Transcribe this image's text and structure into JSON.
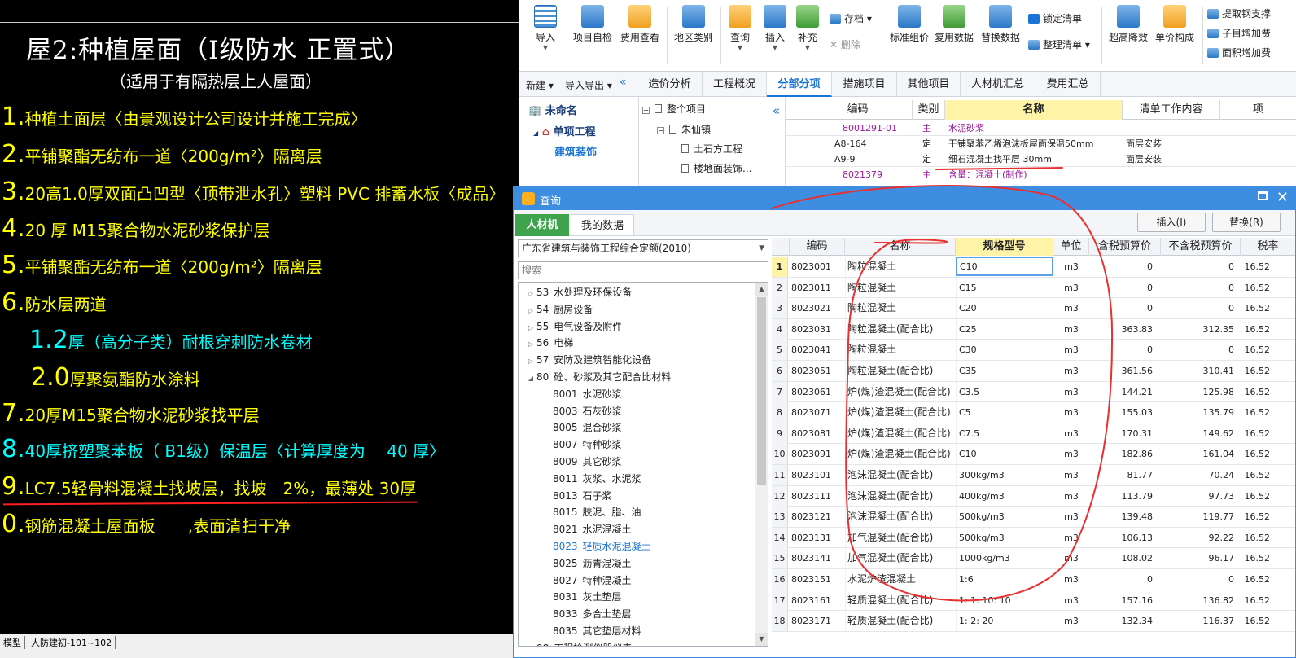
{
  "cad": {
    "title": "屋2:种植屋面（Ⅰ级防水 正置式）",
    "subtitle": "（适用于有隔热层上人屋面）",
    "lines": [
      {
        "num": "1.",
        "text": "种植土面层〈由景观设计公司设计并施工完成〉",
        "color": "yellow"
      },
      {
        "num": "2.",
        "text": "平铺聚酯无纺布一道〈200g/m²〉隔离层",
        "color": "yellow"
      },
      {
        "num": "3.",
        "text": "20高1.0厚双面凸凹型〈顶带泄水孔〉塑料 PVC 排蓄水板〈成品〉",
        "color": "yellow"
      },
      {
        "num": "4.",
        "text": "20 厚 M15聚合物水泥砂浆保护层",
        "color": "yellow"
      },
      {
        "num": "5.",
        "text": "平铺聚酯无纺布一道〈200g/m²〉隔离层",
        "color": "yellow"
      },
      {
        "num": "6.",
        "text": "防水层两道",
        "color": "yellow"
      },
      {
        "num": "1.2",
        "text": "厚（高分子类）耐根穿刺防水卷材",
        "color": "cyan"
      },
      {
        "num": "2.0",
        "text": "厚聚氨酯防水涂料",
        "color": "yellow"
      },
      {
        "num": "7.",
        "text": "20厚M15聚合物水泥砂浆找平层",
        "color": "yellow"
      },
      {
        "num": "8.",
        "text": "40厚挤塑聚苯板（ B1级）保温层〈计算厚度为　 40 厚〉",
        "color": "cyan"
      },
      {
        "num": "9.",
        "text": "LC7.5轻骨料混凝土找坡层，找坡　2%，最薄处 30厚",
        "color": "yellow"
      },
      {
        "num": "0.",
        "text": "钢筋混凝土屋面板　　,表面清扫干净",
        "color": "yellow"
      }
    ],
    "tabs": [
      "模型",
      "人防建初-101~102"
    ]
  },
  "ribbon": {
    "buttons": [
      "导入",
      "项目自检",
      "费用查看",
      "地区类别",
      "查询",
      "插入",
      "补充",
      "标准组价",
      "复用数据",
      "替换数据",
      "超高降效",
      "单价构成"
    ],
    "save": "存档",
    "delete": "删除",
    "lock": "锁定清单",
    "sort": "整理清单",
    "right_items": [
      "提取钢支撑",
      "子目增加费",
      "面积增加费"
    ]
  },
  "navbar": {
    "new": "新建",
    "import_export": "导入导出",
    "tabs": [
      "造价分析",
      "工程概况",
      "分部分项",
      "措施项目",
      "其他项目",
      "人材机汇总",
      "费用汇总"
    ],
    "active_tab": "分部分项"
  },
  "left_tree": {
    "root": "未命名",
    "child": "单项工程",
    "leaf": "建筑装饰"
  },
  "mid_tree": {
    "items": [
      "整个项目",
      "朱仙镇",
      "土石方工程",
      "楼地面装饰..."
    ]
  },
  "top_grid": {
    "headers": [
      "编码",
      "类别",
      "名称",
      "清单工作内容",
      "项"
    ],
    "rows": [
      {
        "code": "8001291-01",
        "type": "主",
        "name": "水泥砂浆",
        "content": "",
        "purple": true
      },
      {
        "code": "A8-164",
        "type": "定",
        "name": "干铺聚苯乙烯泡沫板屋面保温50mm",
        "content": "面层安装",
        "purple": false
      },
      {
        "code": "A9-9",
        "type": "定",
        "name": "细石混凝土找平层 30mm",
        "content": "面层安装",
        "purple": false
      },
      {
        "code": "8021379",
        "type": "主",
        "name": "含量：混凝土(制作)",
        "content": "",
        "purple": true
      }
    ]
  },
  "dialog": {
    "title": "查询",
    "tabs": [
      "人材机",
      "我的数据"
    ],
    "insert_btn": "插入(I)",
    "replace_btn": "替换(R)",
    "library": "广东省建筑与装饰工程综合定额(2010)",
    "search_placeholder": "搜索",
    "categories": [
      {
        "num": "53",
        "name": "水处理及环保设备",
        "level": 0
      },
      {
        "num": "54",
        "name": "厨房设备",
        "level": 0
      },
      {
        "num": "55",
        "name": "电气设备及附件",
        "level": 0
      },
      {
        "num": "56",
        "name": "电梯",
        "level": 0
      },
      {
        "num": "57",
        "name": "安防及建筑智能化设备",
        "level": 0
      },
      {
        "num": "80",
        "name": "砼、砂浆及其它配合比材料",
        "level": 0,
        "expanded": true
      },
      {
        "num": "8001",
        "name": "水泥砂浆",
        "level": 1
      },
      {
        "num": "8003",
        "name": "石灰砂浆",
        "level": 1
      },
      {
        "num": "8005",
        "name": "混合砂浆",
        "level": 1
      },
      {
        "num": "8007",
        "name": "特种砂浆",
        "level": 1
      },
      {
        "num": "8009",
        "name": "其它砂浆",
        "level": 1
      },
      {
        "num": "8011",
        "name": "灰浆、水泥浆",
        "level": 1
      },
      {
        "num": "8013",
        "name": "石子浆",
        "level": 1
      },
      {
        "num": "8015",
        "name": "胶泥、脂、油",
        "level": 1
      },
      {
        "num": "8021",
        "name": "水泥混凝土",
        "level": 1
      },
      {
        "num": "8023",
        "name": "轻质水泥混凝土",
        "level": 1,
        "selected": true
      },
      {
        "num": "8025",
        "name": "沥青混凝土",
        "level": 1
      },
      {
        "num": "8027",
        "name": "特种混凝土",
        "level": 1
      },
      {
        "num": "8031",
        "name": "灰土垫层",
        "level": 1
      },
      {
        "num": "8033",
        "name": "多合土垫层",
        "level": 1
      },
      {
        "num": "8035",
        "name": "其它垫层材料",
        "level": 1
      },
      {
        "num": "98",
        "name": "工程检测仪器仪表",
        "level": 0
      }
    ],
    "headers": [
      "编码",
      "名称",
      "规格型号",
      "单位",
      "含税预算价",
      "不含税预算价",
      "税率"
    ],
    "rows": [
      {
        "n": "1",
        "code": "8023001",
        "name": "陶粒混凝土",
        "spec": "C10",
        "unit": "m3",
        "tax": "0",
        "ntax": "0",
        "rate": "16.52"
      },
      {
        "n": "2",
        "code": "8023011",
        "name": "陶粒混凝土",
        "spec": "C15",
        "unit": "m3",
        "tax": "0",
        "ntax": "0",
        "rate": "16.52"
      },
      {
        "n": "3",
        "code": "8023021",
        "name": "陶粒混凝土",
        "spec": "C20",
        "unit": "m3",
        "tax": "0",
        "ntax": "0",
        "rate": "16.52"
      },
      {
        "n": "4",
        "code": "8023031",
        "name": "陶粒混凝土(配合比)",
        "spec": "C25",
        "unit": "m3",
        "tax": "363.83",
        "ntax": "312.35",
        "rate": "16.52"
      },
      {
        "n": "5",
        "code": "8023041",
        "name": "陶粒混凝土",
        "spec": "C30",
        "unit": "m3",
        "tax": "0",
        "ntax": "0",
        "rate": "16.52"
      },
      {
        "n": "6",
        "code": "8023051",
        "name": "陶粒混凝土(配合比)",
        "spec": "C35",
        "unit": "m3",
        "tax": "361.56",
        "ntax": "310.41",
        "rate": "16.52"
      },
      {
        "n": "7",
        "code": "8023061",
        "name": "炉(煤)渣混凝土(配合比)",
        "spec": "C3.5",
        "unit": "m3",
        "tax": "144.21",
        "ntax": "125.98",
        "rate": "16.52"
      },
      {
        "n": "8",
        "code": "8023071",
        "name": "炉(煤)渣混凝土(配合比)",
        "spec": "C5",
        "unit": "m3",
        "tax": "155.03",
        "ntax": "135.79",
        "rate": "16.52"
      },
      {
        "n": "9",
        "code": "8023081",
        "name": "炉(煤)渣混凝土(配合比)",
        "spec": "C7.5",
        "unit": "m3",
        "tax": "170.31",
        "ntax": "149.62",
        "rate": "16.52"
      },
      {
        "n": "10",
        "code": "8023091",
        "name": "炉(煤)渣混凝土(配合比)",
        "spec": "C10",
        "unit": "m3",
        "tax": "182.86",
        "ntax": "161.04",
        "rate": "16.52"
      },
      {
        "n": "11",
        "code": "8023101",
        "name": "泡沫混凝土(配合比)",
        "spec": "300kg/m3",
        "unit": "m3",
        "tax": "81.77",
        "ntax": "70.24",
        "rate": "16.52"
      },
      {
        "n": "12",
        "code": "8023111",
        "name": "泡沫混凝土(配合比)",
        "spec": "400kg/m3",
        "unit": "m3",
        "tax": "113.79",
        "ntax": "97.73",
        "rate": "16.52"
      },
      {
        "n": "13",
        "code": "8023121",
        "name": "泡沫混凝土(配合比)",
        "spec": "500kg/m3",
        "unit": "m3",
        "tax": "139.48",
        "ntax": "119.77",
        "rate": "16.52"
      },
      {
        "n": "14",
        "code": "8023131",
        "name": "加气混凝土(配合比)",
        "spec": "500kg/m3",
        "unit": "m3",
        "tax": "106.13",
        "ntax": "92.22",
        "rate": "16.52"
      },
      {
        "n": "15",
        "code": "8023141",
        "name": "加气混凝土(配合比)",
        "spec": "1000kg/m3",
        "unit": "m3",
        "tax": "108.02",
        "ntax": "96.17",
        "rate": "16.52"
      },
      {
        "n": "16",
        "code": "8023151",
        "name": "水泥炉渣混凝土",
        "spec": "1:6",
        "unit": "m3",
        "tax": "0",
        "ntax": "0",
        "rate": "16.52"
      },
      {
        "n": "17",
        "code": "8023161",
        "name": "轻质混凝土(配合比)",
        "spec": "1: 1: 10: 10",
        "unit": "m3",
        "tax": "157.16",
        "ntax": "136.82",
        "rate": "16.52"
      },
      {
        "n": "18",
        "code": "8023171",
        "name": "轻质混凝土(配合比)",
        "spec": "1: 2: 20",
        "unit": "m3",
        "tax": "132.34",
        "ntax": "116.37",
        "rate": "16.52"
      }
    ]
  },
  "colors": {
    "cad_yellow": "#ffff00",
    "cad_cyan": "#00ffff",
    "accent_blue": "#3d8de0",
    "tab_green": "#3fa34d",
    "annotation_red": "#e83030",
    "highlight_yellow": "#fff3a8"
  }
}
